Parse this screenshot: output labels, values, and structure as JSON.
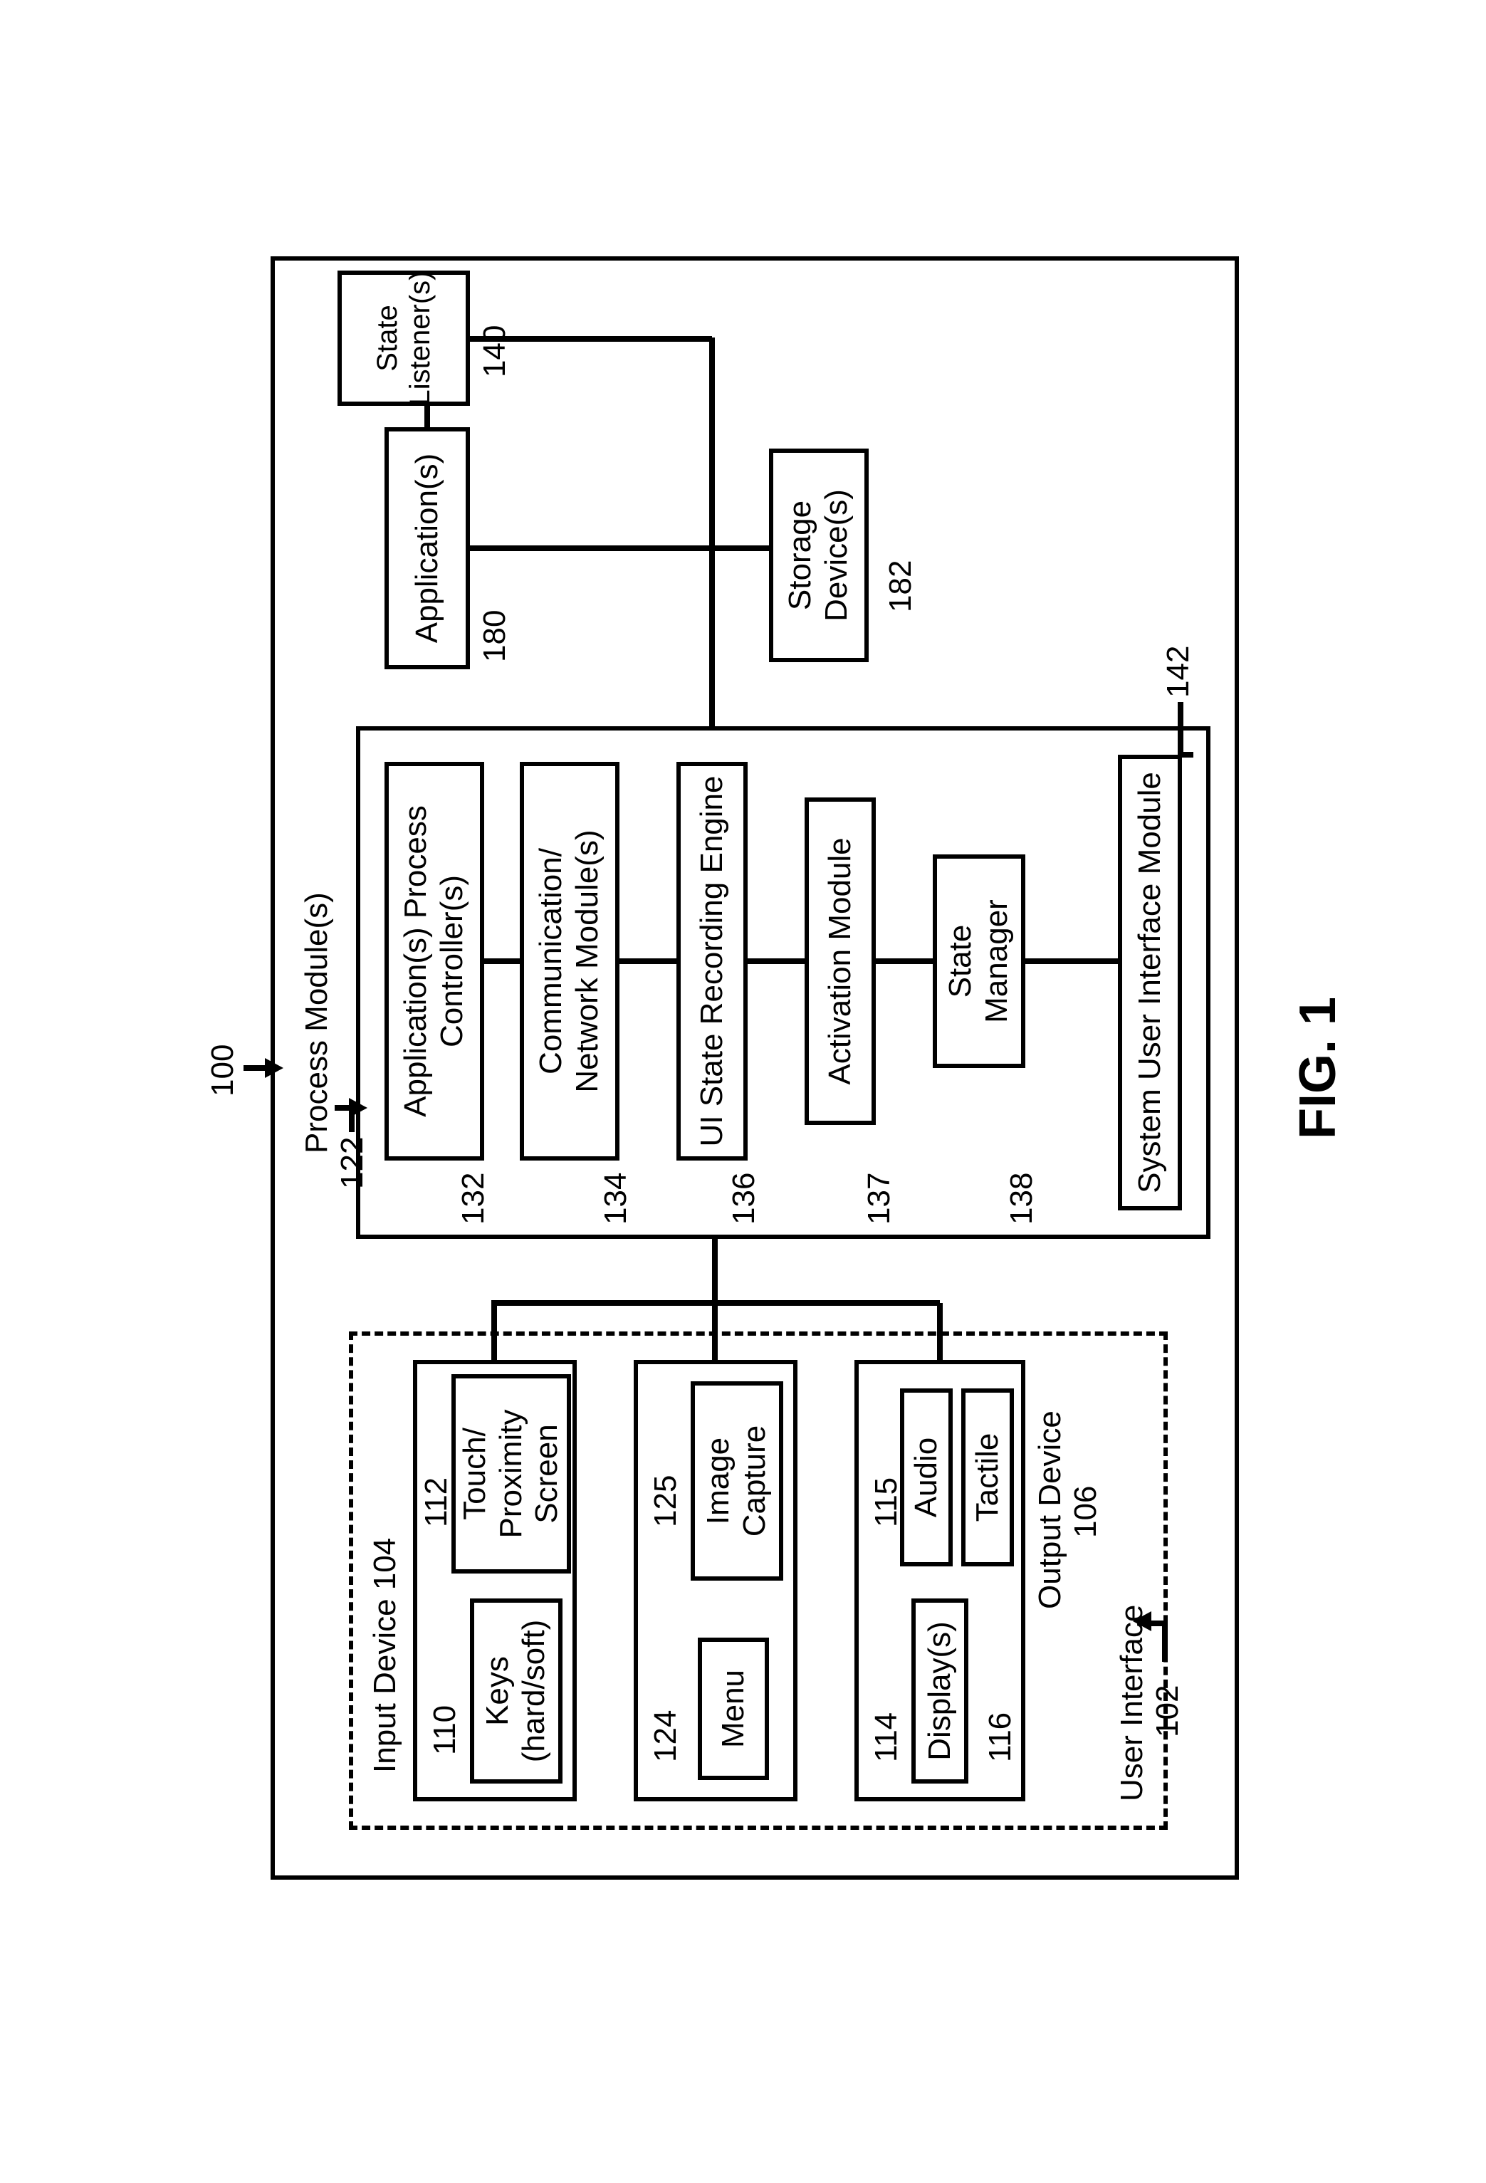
{
  "figure_label": "FIG. 1",
  "refs": {
    "system": "100",
    "user_interface": "102",
    "input_device": "104",
    "output_device": "106",
    "keys": "110",
    "touch": "112",
    "displays": "114",
    "audio": "115",
    "tactile": "116",
    "process_modules": "122",
    "menu": "124",
    "image_capture": "125",
    "app_process_ctrl": "132",
    "comm_network": "134",
    "ui_state_engine": "136",
    "activation": "137",
    "state_manager": "138",
    "state_listener": "140",
    "sys_ui_module": "142",
    "applications": "180",
    "storage": "182"
  },
  "labels": {
    "user_interface": "User Interface",
    "input_device": "Input Device",
    "output_device": "Output Device",
    "keys_l1": "Keys",
    "keys_l2": "(hard/soft)",
    "touch_l1": "Touch/",
    "touch_l2": "Proximity",
    "touch_l3": "Screen",
    "menu": "Menu",
    "image_capture_l1": "Image",
    "image_capture_l2": "Capture",
    "displays": "Display(s)",
    "audio": "Audio",
    "tactile": "Tactile",
    "process_modules": "Process Module(s)",
    "app_proc_l1": "Application(s) Process",
    "app_proc_l2": "Controller(s)",
    "comm_l1": "Communication/",
    "comm_l2": "Network Module(s)",
    "ui_state_engine": "UI State Recording Engine",
    "activation": "Activation Module",
    "state_manager_l1": "State",
    "state_manager_l2": "Manager",
    "sys_ui_module": "System User Interface Module",
    "applications": "Application(s)",
    "state_listener": "State Listener(s)",
    "storage_l1": "Storage",
    "storage_l2": "Device(s)"
  }
}
